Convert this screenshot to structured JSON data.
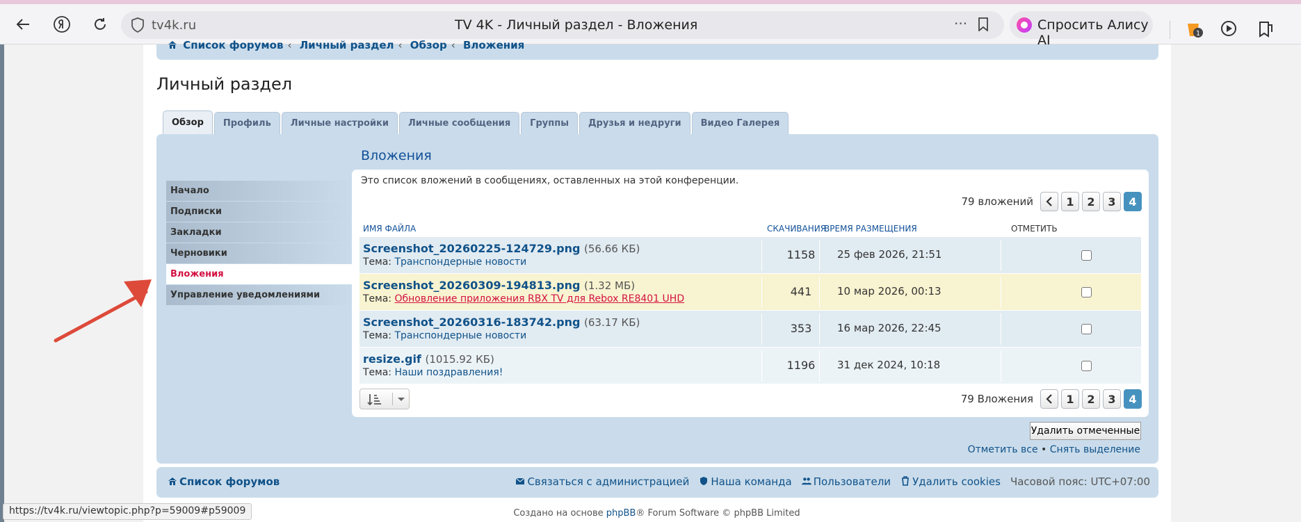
{
  "browser": {
    "host": "tv4k.ru",
    "tab_title": "TV 4K - Личный раздел - Вложения",
    "alice_label": "Спросить Алису AI",
    "status_url": "https://tv4k.ru/viewtopic.php?p=59009#p59009"
  },
  "breadcrumbs": [
    "Список форумов",
    "Личный раздел",
    "Обзор",
    "Вложения"
  ],
  "page_title": "Личный раздел",
  "tabs": [
    {
      "label": "Обзор"
    },
    {
      "label": "Профиль"
    },
    {
      "label": "Личные настройки"
    },
    {
      "label": "Личные сообщения"
    },
    {
      "label": "Группы"
    },
    {
      "label": "Друзья и недруги"
    },
    {
      "label": "Видео Галерея"
    }
  ],
  "sidebar": {
    "items": [
      {
        "label": "Начало"
      },
      {
        "label": "Подписки"
      },
      {
        "label": "Закладки"
      },
      {
        "label": "Черновики"
      },
      {
        "label": "Вложения"
      },
      {
        "label": "Управление уведомлениями"
      }
    ]
  },
  "section_title": "Вложения",
  "intro": "Это список вложений в сообщениях, оставленных на этой конференции.",
  "pagination": {
    "top_count": "79 вложений",
    "bottom_count": "79 Вложения",
    "pages": [
      "1",
      "2",
      "3",
      "4"
    ]
  },
  "table": {
    "headers": {
      "filename": "Имя файла",
      "downloads": "Скачивания",
      "time": "Время размещения",
      "mark": "Отметить"
    },
    "topic_prefix": "Тема:",
    "rows": [
      {
        "file": "Screenshot_20260225-124729.png",
        "size": "(56.66 КБ)",
        "topic": "Транспондерные новости",
        "downloads": "1158",
        "time": "25 фев 2026, 21:51"
      },
      {
        "file": "Screenshot_20260309-194813.png",
        "size": "(1.32 МБ)",
        "topic": "Обновление приложения RBX TV для Rebox RE8401 UHD",
        "downloads": "441",
        "time": "10 мар 2026, 00:13"
      },
      {
        "file": "Screenshot_20260316-183742.png",
        "size": "(63.17 КБ)",
        "topic": "Транспондерные новости",
        "downloads": "353",
        "time": "16 мар 2026, 22:45"
      },
      {
        "file": "resize.gif",
        "size": "(1015.92 КБ)",
        "topic": "Наши поздравления!",
        "downloads": "1196",
        "time": "31 дек 2024, 10:18"
      }
    ]
  },
  "actions": {
    "delete_marked": "Удалить отмеченные",
    "mark_all": "Отметить все",
    "bullet": "•",
    "unmark": "Снять выделение"
  },
  "footer": {
    "forum_list": "Список форумов",
    "contact": "Связаться с администрацией",
    "team": "Наша команда",
    "users": "Пользователи",
    "cookies": "Удалить cookies",
    "timezone": "Часовой пояс: UTC+07:00",
    "copyright_pre": "Создано на основе",
    "copyright_brand": "phpBB",
    "copyright_post": "® Forum Software © phpBB Limited"
  }
}
